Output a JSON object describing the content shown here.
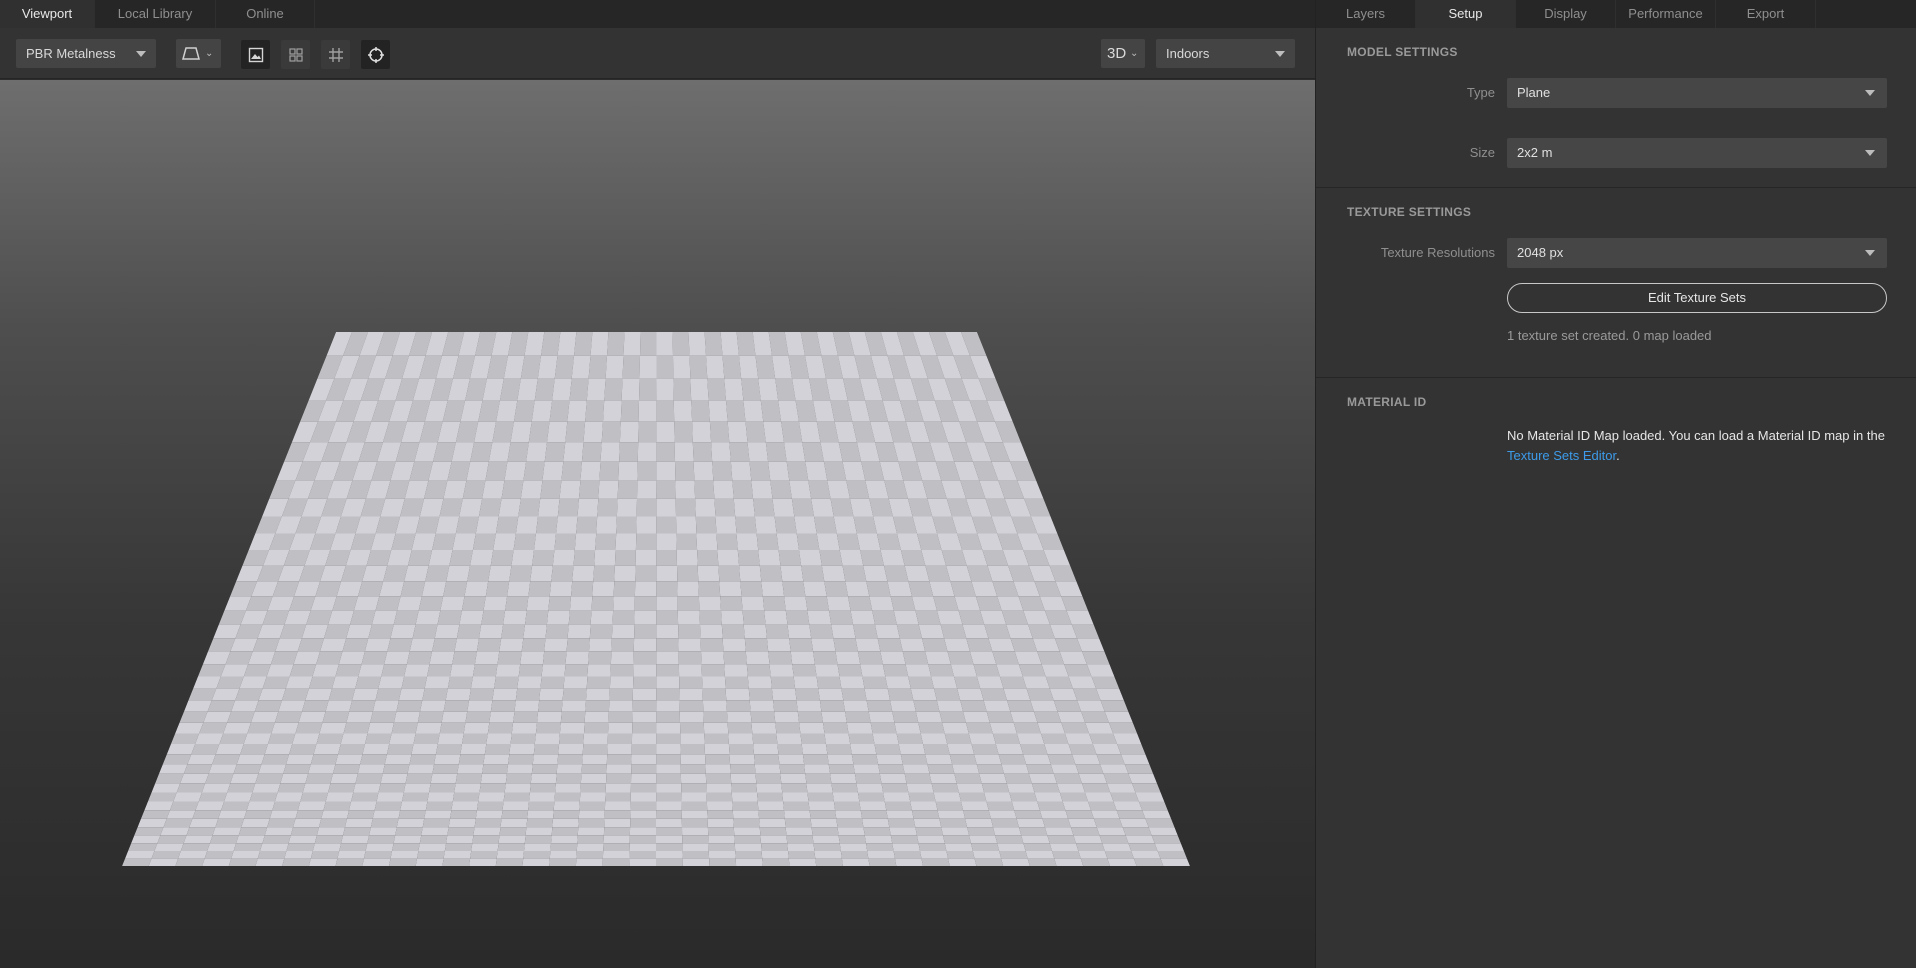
{
  "left_tabs": [
    {
      "label": "Viewport",
      "active": true
    },
    {
      "label": "Local Library",
      "active": false
    },
    {
      "label": "Online",
      "active": false
    }
  ],
  "toolbar": {
    "shader_dropdown": "PBR Metalness",
    "view_mode": "3D",
    "environment": "Indoors",
    "icons": [
      "perspective-icon",
      "image-icon",
      "grid-2x2-icon",
      "grid-lines-icon",
      "crosshair-icon"
    ]
  },
  "right_tabs": [
    {
      "label": "Layers",
      "active": false
    },
    {
      "label": "Setup",
      "active": true
    },
    {
      "label": "Display",
      "active": false
    },
    {
      "label": "Performance",
      "active": false
    },
    {
      "label": "Export",
      "active": false
    }
  ],
  "model_settings": {
    "title": "MODEL SETTINGS",
    "type_label": "Type",
    "type_value": "Plane",
    "size_label": "Size",
    "size_value": "2x2 m"
  },
  "texture_settings": {
    "title": "TEXTURE SETTINGS",
    "resolution_label": "Texture Resolutions",
    "resolution_value": "2048 px",
    "edit_button": "Edit Texture Sets",
    "status": "1 texture set created. 0 map loaded"
  },
  "material_id": {
    "title": "MATERIAL ID",
    "message": "No Material ID Map loaded. You can load a Material ID map in the",
    "link": "Texture Sets Editor",
    "suffix": "."
  },
  "colors": {
    "accent_link": "#3d9bea",
    "panel_bg": "#333333",
    "checker_light": "#d2d2d8",
    "checker_dark": "#bfbfc4"
  }
}
